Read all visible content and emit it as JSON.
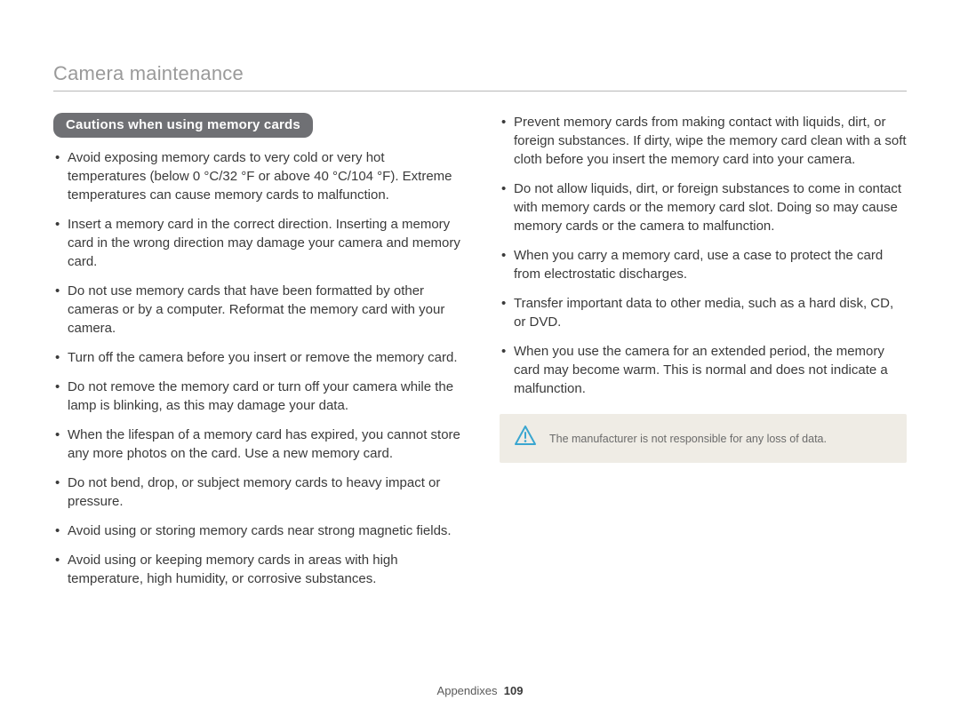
{
  "header": {
    "title": "Camera maintenance"
  },
  "section": {
    "heading": "Cautions when using memory cards"
  },
  "left_bullets": [
    "Avoid exposing memory cards to very cold or very hot temperatures (below 0 °C/32 °F or above 40 °C/104 °F). Extreme temperatures can cause memory cards to malfunction.",
    "Insert a memory card in the correct direction. Inserting a memory card in the wrong direction may damage your camera and memory card.",
    "Do not use memory cards that have been formatted by other cameras or by a computer. Reformat the memory card with your camera.",
    "Turn off the camera before you insert or remove the memory card.",
    "Do not remove the memory card or turn off your camera while the lamp is blinking, as this may damage your data.",
    "When the lifespan of a memory card has expired, you cannot store any more photos on the card. Use a new memory card.",
    "Do not bend, drop, or subject memory cards to heavy impact or pressure.",
    "Avoid using or storing memory cards near strong magnetic fields.",
    "Avoid using or keeping memory cards in areas with high temperature, high humidity, or corrosive substances."
  ],
  "right_bullets": [
    "Prevent memory cards from making contact with liquids, dirt, or foreign substances. If dirty, wipe the memory card clean with a soft cloth before you insert the memory card into your camera.",
    "Do not allow liquids, dirt, or foreign substances to come in contact with memory cards or the memory card slot. Doing so may cause memory cards or the camera to malfunction.",
    "When you carry a memory card, use a case to protect the card from electrostatic discharges.",
    "Transfer important data to other media, such as a hard disk, CD, or DVD.",
    "When you use the camera for an extended period, the memory card may become warm. This is normal and does not indicate a malfunction."
  ],
  "note": {
    "text": "The manufacturer is not responsible for any loss of data."
  },
  "footer": {
    "label": "Appendixes",
    "page": "109"
  }
}
